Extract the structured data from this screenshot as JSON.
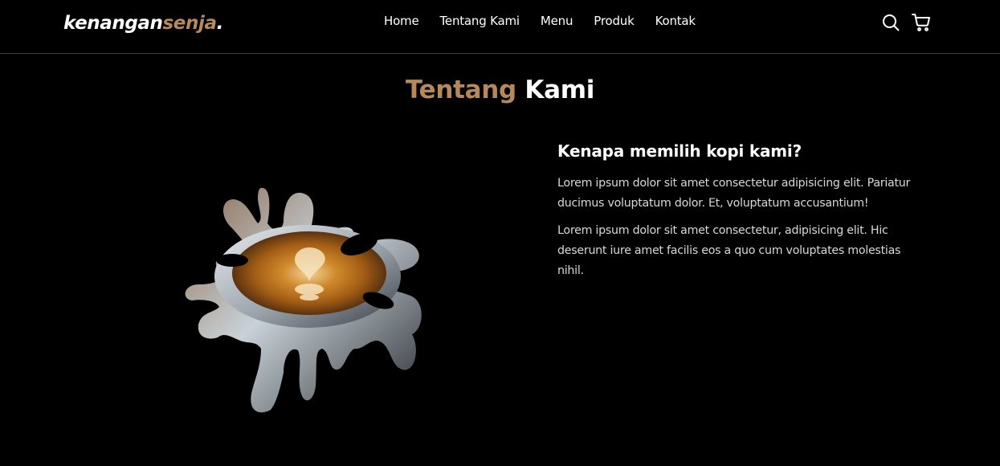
{
  "logo": {
    "part1": "kenangan",
    "part2": "senja",
    "part3": "."
  },
  "nav": {
    "items": [
      {
        "label": "Home"
      },
      {
        "label": "Tentang Kami"
      },
      {
        "label": "Menu"
      },
      {
        "label": "Produk"
      },
      {
        "label": "Kontak"
      }
    ],
    "icons": [
      "search-icon",
      "shopping-cart-icon"
    ]
  },
  "about": {
    "title_part1": "Tentang",
    "title_part2": "Kami",
    "heading": "Kenapa memilih kopi kami?",
    "paragraphs": [
      "Lorem ipsum dolor sit amet consectetur adipisicing elit. Pariatur ducimus voluptatum dolor. Et, voluptatum accusantium!",
      "Lorem ipsum dolor sit amet consectetur, adipisicing elit. Hic deserunt iure amet facilis eos a quo cum voluptates molestias nihil."
    ]
  },
  "colors": {
    "accent": "#b6895b",
    "background": "#000000",
    "text": "#ffffff",
    "border": "#4a3a29"
  }
}
